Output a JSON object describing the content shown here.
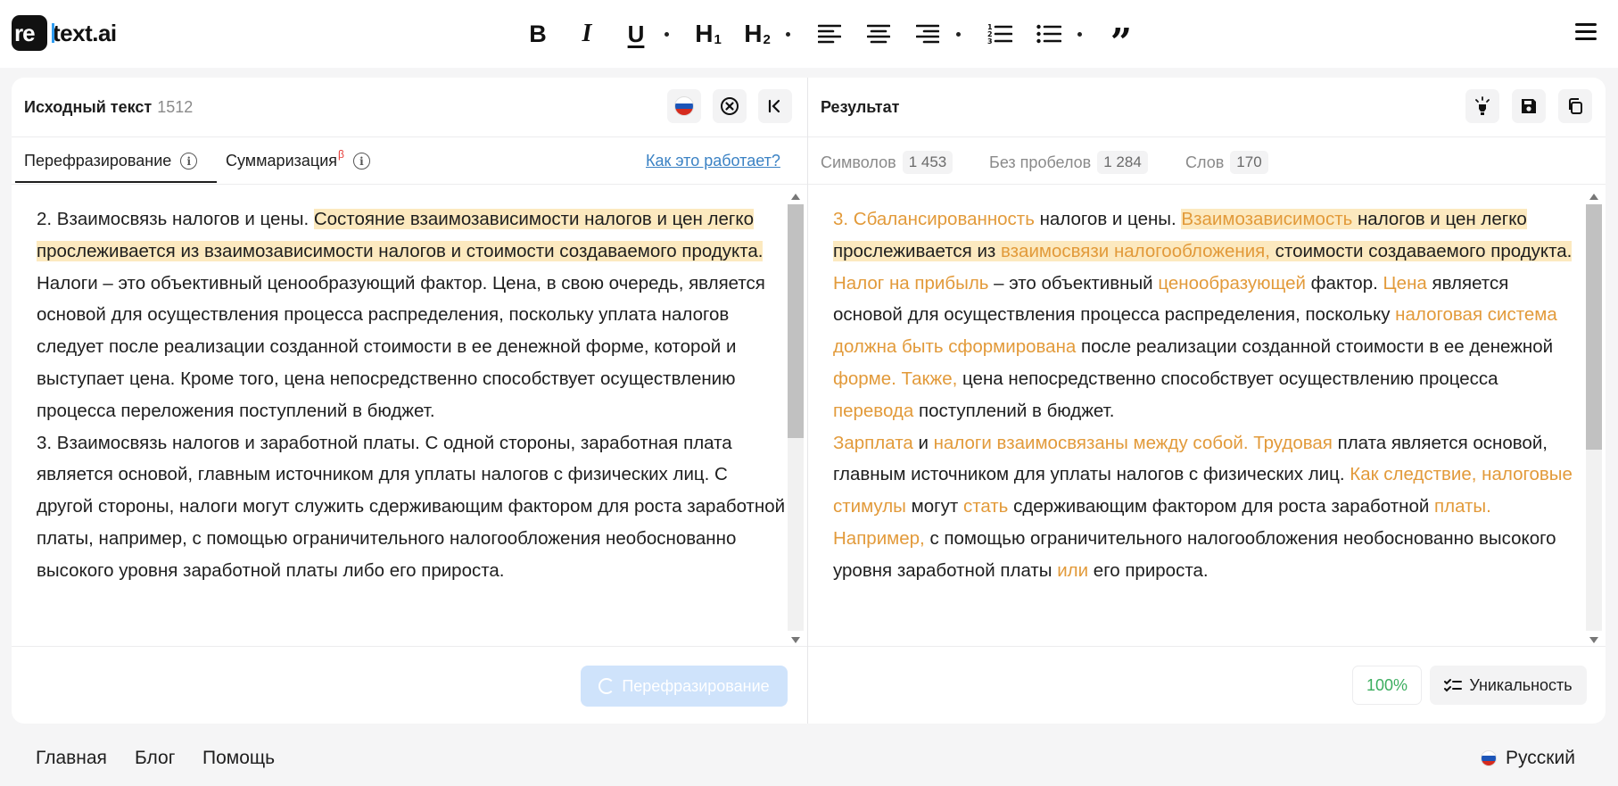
{
  "brand": {
    "logo_mark": "re",
    "logo_text": "text.ai"
  },
  "toolbar": {
    "bold": "B",
    "italic": "I",
    "underline": "U",
    "h1": "H",
    "h1_sub": "1",
    "h2": "H",
    "h2_sub": "2",
    "quote": "”"
  },
  "source": {
    "title": "Исходный текст",
    "count": "1512",
    "tab_paraphrase": "Перефразирование",
    "tab_summary": "Суммаризация",
    "tab_summary_badge": "β",
    "how_link": "Как это работает?",
    "action_button": "Перефразирование",
    "segments": [
      {
        "t": "2. Взаимосвязь налогов и цены. "
      },
      {
        "t": "Состояние взаимозависимости налогов и цен легко прослеживается из взаимозависимости налогов и стоимости создаваемого продукта.",
        "c": "hl"
      },
      {
        "t": " Налоги – это объективный ценообразующий фактор. Цена, в свою очередь, является основой для осуществления процесса распределения, поскольку уплата налогов следует после реализации созданной стоимости в ее денежной форме, которой и выступает цена. Кроме того, цена непосредственно способствует осуществлению процесса переложения поступлений в бюджет."
      },
      {
        "t": "\n3. Взаимосвязь налогов и заработной платы. С одной стороны, заработная плата является основой, главным источником для уплаты налогов с физических лиц. С другой стороны, налоги могут служить сдерживающим фактором для роста заработной платы, например, с помощью ограничительного налогообложения необоснованно высокого уровня заработной платы либо его прироста."
      }
    ]
  },
  "result": {
    "title": "Результат",
    "stats": [
      {
        "label": "Символов",
        "value": "1 453"
      },
      {
        "label": "Без пробелов",
        "value": "1 284"
      },
      {
        "label": "Слов",
        "value": "170"
      }
    ],
    "uniqueness_pct": "100%",
    "uniqueness_label": "Уникальность",
    "segments": [
      {
        "t": "3. Сбалансированность",
        "c": "ch"
      },
      {
        "t": " налогов и цены. "
      },
      {
        "t": "Взаимозависимость",
        "c": "ch hl"
      },
      {
        "t": " налогов и цен легко прослеживается из ",
        "c": "hl"
      },
      {
        "t": "взаимосвязи налогообложения,",
        "c": "ch hl"
      },
      {
        "t": " стоимости создаваемого продукта.",
        "c": "hl"
      },
      {
        "t": " "
      },
      {
        "t": "Налог на прибыль",
        "c": "ch"
      },
      {
        "t": " – это объективный "
      },
      {
        "t": "ценообразующей",
        "c": "ch"
      },
      {
        "t": " фактор. "
      },
      {
        "t": "Цена",
        "c": "ch"
      },
      {
        "t": " является основой для осуществления процесса распределения, поскольку "
      },
      {
        "t": "налоговая система должна быть сформирована",
        "c": "ch"
      },
      {
        "t": " после реализации созданной стоимости в ее денежной "
      },
      {
        "t": "форме. Также,",
        "c": "ch"
      },
      {
        "t": " цена непосредственно способствует осуществлению процесса "
      },
      {
        "t": "перевода",
        "c": "ch"
      },
      {
        "t": " поступлений в бюджет.\n"
      },
      {
        "t": "Зарплата",
        "c": "ch"
      },
      {
        "t": " и "
      },
      {
        "t": "налоги взаимосвязаны между собой. Трудовая",
        "c": "ch"
      },
      {
        "t": " плата является основой, главным источником для уплаты налогов с физических лиц. "
      },
      {
        "t": "Как следствие, налоговые стимулы",
        "c": "ch"
      },
      {
        "t": " могут "
      },
      {
        "t": "стать",
        "c": "ch"
      },
      {
        "t": " сдерживающим фактором для роста заработной "
      },
      {
        "t": "платы. Например,",
        "c": "ch"
      },
      {
        "t": " с помощью ограничительного налогообложения необоснованно высокого уровня заработной платы "
      },
      {
        "t": "или",
        "c": "ch"
      },
      {
        "t": " его прироста."
      }
    ]
  },
  "footer": {
    "home": "Главная",
    "blog": "Блог",
    "help": "Помощь",
    "language": "Русский"
  },
  "colors": {
    "accent": "#3b82c4",
    "highlight": "#fce9bf",
    "changed_text": "#e29a3a",
    "uniqueness": "#3cae5f"
  }
}
